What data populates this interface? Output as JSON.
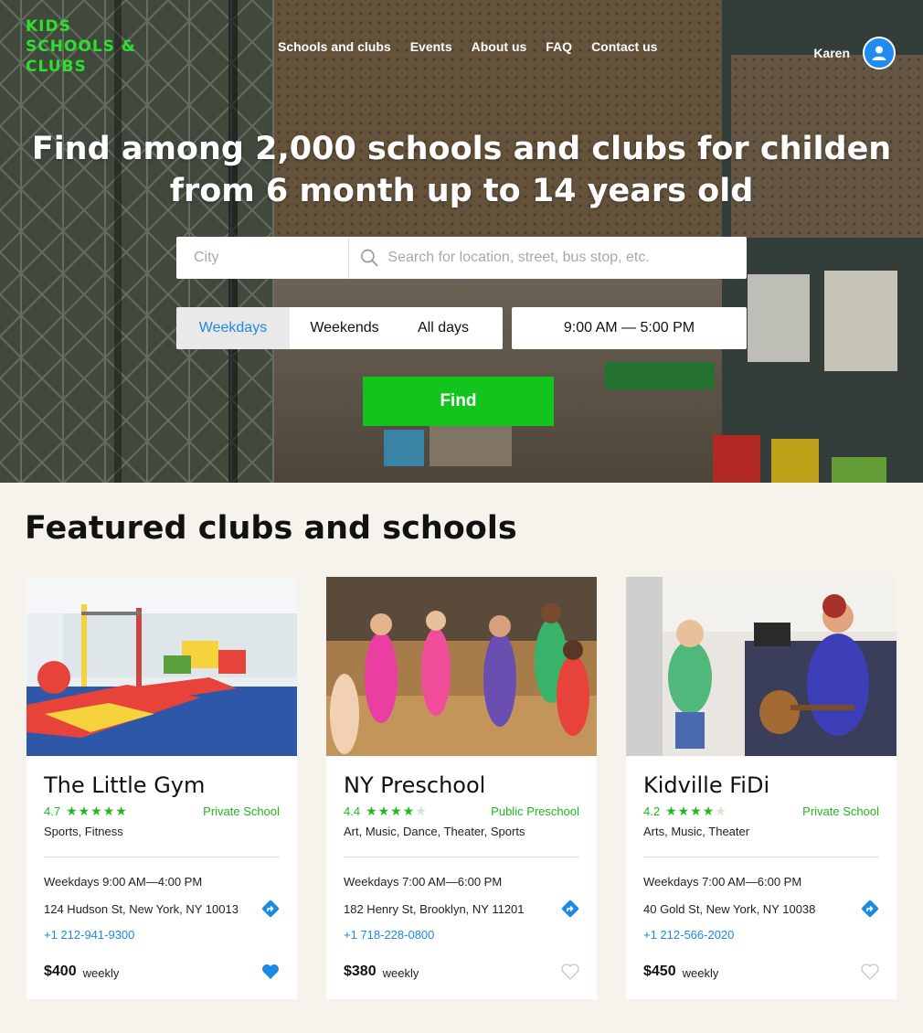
{
  "brand": {
    "line1": "KIDS",
    "line2": "SCHOOLS &",
    "line3": "CLUBS",
    "color": "#2ee02e"
  },
  "nav": [
    "Schools and clubs",
    "Events",
    "About us",
    "FAQ",
    "Contact us"
  ],
  "user": {
    "name": "Karen",
    "avatar_icon": "user-icon"
  },
  "hero": {
    "headline_line1": "Find among 2,000 schools and clubs for childen",
    "headline_line2": "from 6 month up to 14 years old"
  },
  "search": {
    "city_placeholder": "City",
    "location_placeholder": "Search for location, street, bus stop, etc.",
    "days": [
      "Weekdays",
      "Weekends",
      "All days"
    ],
    "selected_day": "Weekdays",
    "time_range": "9:00 AM — 5:00 PM",
    "find_label": "Find",
    "accent": "#12c51c"
  },
  "featured": {
    "title": "Featured clubs and schools",
    "cards": [
      {
        "name": "The Little Gym",
        "rating": "4.7",
        "stars": 5,
        "type": "Private School",
        "tags": "Sports, Fitness",
        "hours": "Weekdays 9:00 AM—4:00 PM",
        "address": "124 Hudson St, New York, NY 10013",
        "phone": "+1 212-941-9300",
        "price": "$400",
        "period": "weekly",
        "favorite": true
      },
      {
        "name": "NY Preschool",
        "rating": "4.4",
        "stars": 4,
        "type": "Public Preschool",
        "tags": "Art, Music, Dance, Theater, Sports",
        "hours": "Weekdays 7:00 AM—6:00 PM",
        "address": "182 Henry St, Brooklyn, NY 11201",
        "phone": "+1 718-228-0800",
        "price": "$380",
        "period": "weekly",
        "favorite": false
      },
      {
        "name": "Kidville FiDi",
        "rating": "4.2",
        "stars": 4,
        "type": "Private School",
        "tags": "Arts, Music, Theater",
        "hours": "Weekdays 7:00 AM—6:00 PM",
        "address": "40 Gold St, New York, NY 10038",
        "phone": "+1 212-566-2020",
        "price": "$450",
        "period": "weekly",
        "favorite": false
      }
    ]
  }
}
